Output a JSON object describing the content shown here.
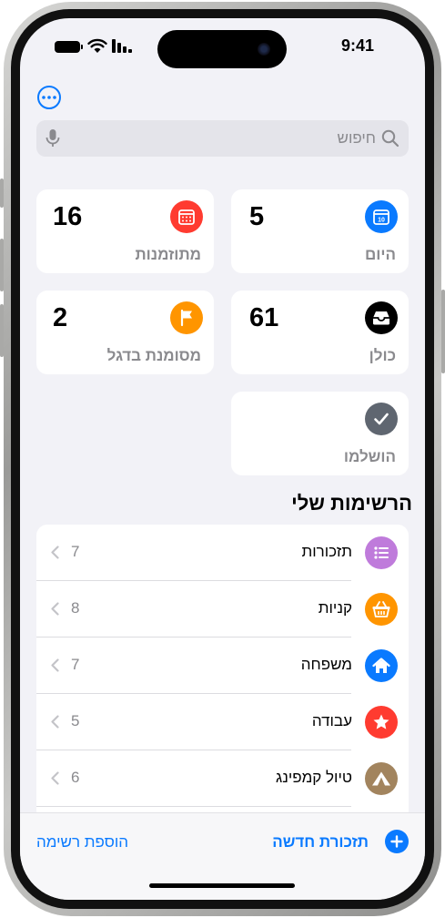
{
  "status_bar": {
    "time": "9:41"
  },
  "search": {
    "placeholder": "חיפוש"
  },
  "smart_lists": {
    "today": {
      "label": "היום",
      "count": "5",
      "calendar_day": "10"
    },
    "scheduled": {
      "label": "מתוזמנות",
      "count": "16"
    },
    "all": {
      "label": "כולן",
      "count": "61"
    },
    "flagged": {
      "label": "מסומנת בדגל",
      "count": "2"
    },
    "completed": {
      "label": "הושלמו"
    }
  },
  "my_lists": {
    "title": "הרשימות שלי",
    "items": [
      {
        "name": "תזכורות",
        "count": "7",
        "icon": "list-bullet-icon",
        "color": "#bf7bdb"
      },
      {
        "name": "קניות",
        "count": "8",
        "icon": "basket-icon",
        "color": "#ff9500"
      },
      {
        "name": "משפחה",
        "count": "7",
        "icon": "house-icon",
        "color": "#0a7aff"
      },
      {
        "name": "עבודה",
        "count": "5",
        "icon": "star-icon",
        "color": "#ff3b30"
      },
      {
        "name": "טיול קמפינג",
        "count": "6",
        "icon": "tent-icon",
        "color": "#a2845e"
      }
    ]
  },
  "toolbar": {
    "new_reminder": "תזכורת חדשה",
    "add_list": "הוספת רשימה"
  },
  "colors": {
    "accent": "#0a7aff",
    "today": "#0a7aff",
    "scheduled": "#ff3b30",
    "all": "#000000",
    "flagged": "#ff9500",
    "completed": "#5f6670"
  }
}
